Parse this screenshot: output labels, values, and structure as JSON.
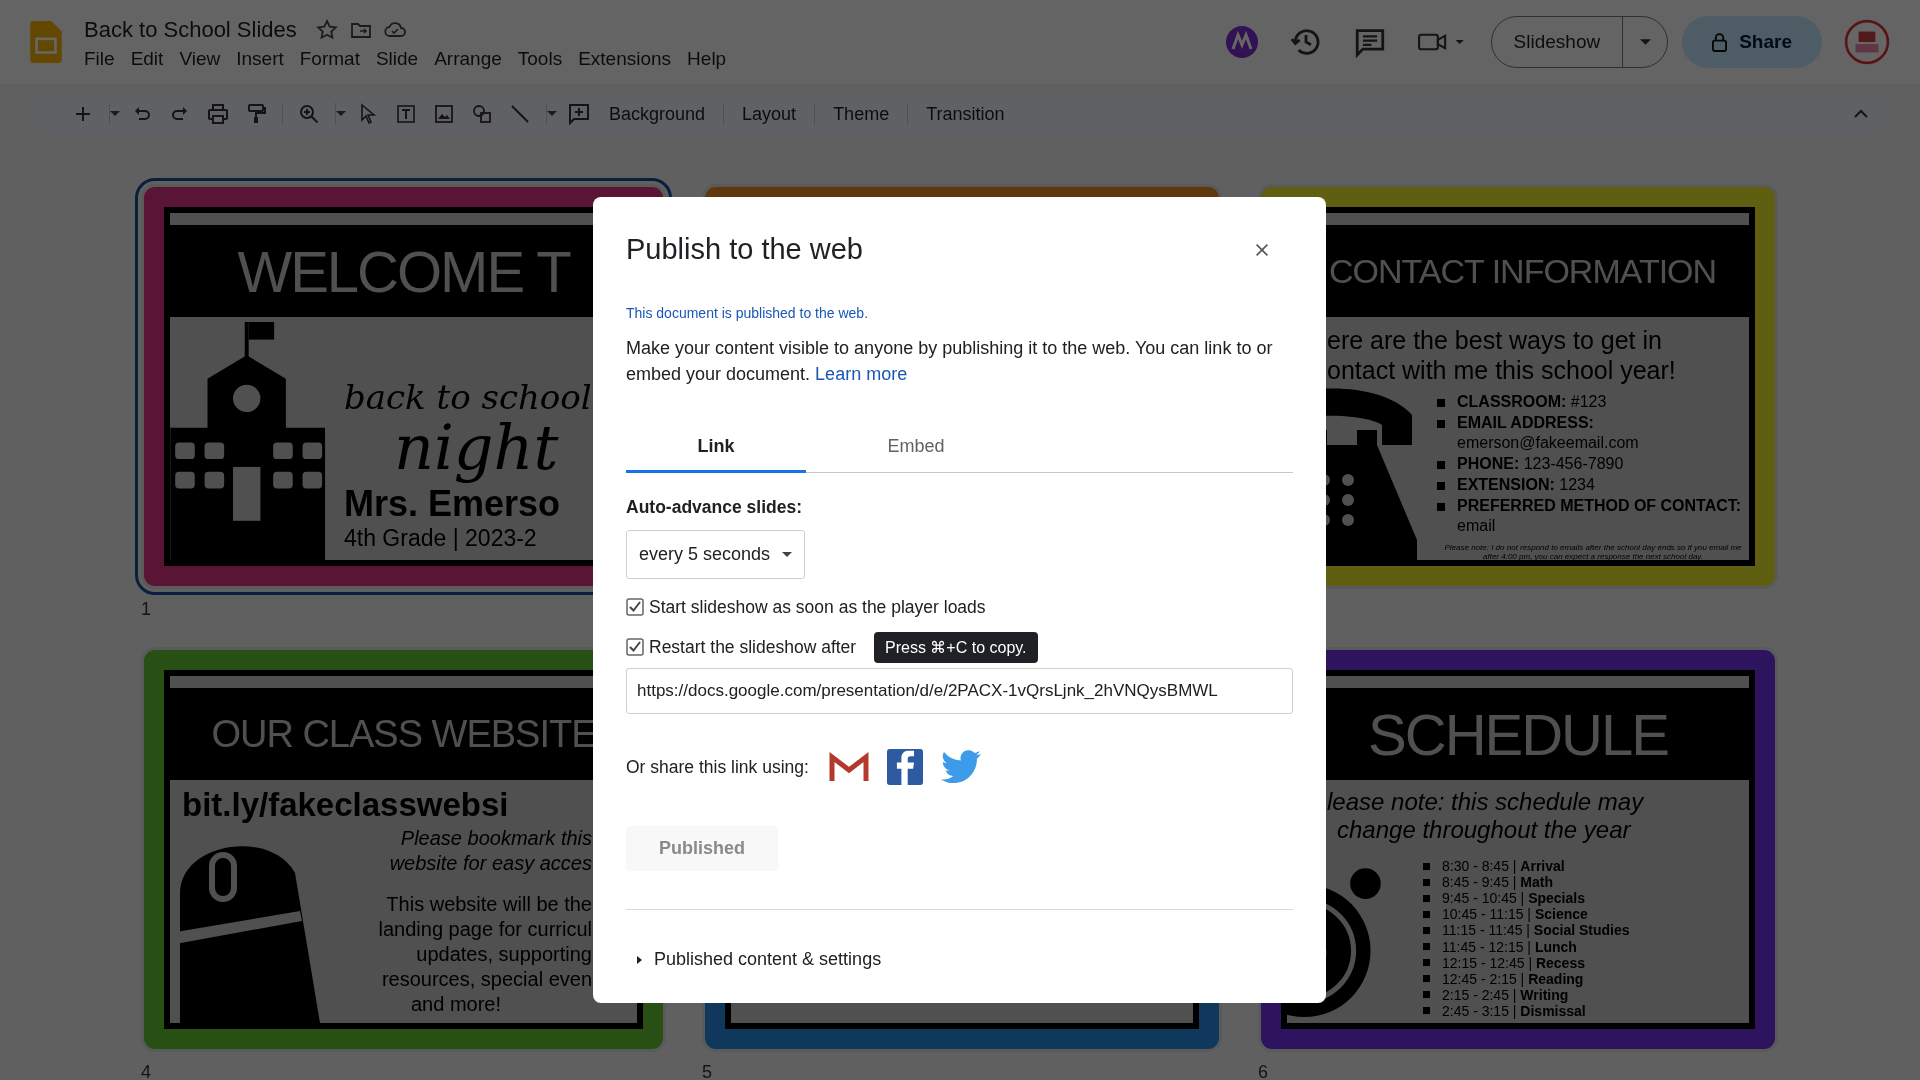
{
  "document": {
    "title": "Back to School Slides"
  },
  "menu": [
    "File",
    "Edit",
    "View",
    "Insert",
    "Format",
    "Slide",
    "Arrange",
    "Tools",
    "Extensions",
    "Help"
  ],
  "actions": {
    "slideshow": "Slideshow",
    "share": "Share"
  },
  "toolbar": [
    "Background",
    "Layout",
    "Theme",
    "Transition"
  ],
  "slides": [
    {
      "number": "1",
      "kind": "welcome",
      "selected": true,
      "title": "WELCOME T",
      "lines": [
        "back to school",
        "night",
        "Mrs. Emerso",
        "4th Grade | 2023-2"
      ]
    },
    {
      "kind": "hidden",
      "selected": false
    },
    {
      "kind": "contact",
      "selected": false,
      "title": "CONTACT INFORMATION",
      "intro": [
        "ere are the best ways to get in",
        "ontact with me this school year!"
      ],
      "items": [
        "**CLASSROOM:** #123",
        "**EMAIL ADDRESS:** emerson@fakeemail.com",
        "**PHONE:** 123-456-7890",
        "**EXTENSION:** 1234",
        "**PREFERRED METHOD OF CONTACT:** email"
      ],
      "note": "Please note: I do not respond to emails after the school day ends so if you email me after 4:00 pm, you can expect a response the next school day."
    },
    {
      "number": "4",
      "kind": "website",
      "selected": false,
      "title": "OUR CLASS WEBSITE",
      "link": "bit.ly/fakeclasswebsi",
      "lines": [
        "Please bookmark this",
        "website for easy acces",
        "This website will be the",
        "landing page for curricul",
        "updates, supporting",
        "resources, special even",
        "and more!"
      ]
    },
    {
      "number": "5",
      "kind": "hidden",
      "selected": false
    },
    {
      "number": "6",
      "kind": "schedule",
      "selected": false,
      "title": "SCHEDULE",
      "intro": [
        "lease note: this schedule may",
        "change throughout the year"
      ],
      "items": [
        "8:30 - 8:45 | **Arrival**",
        "8:45 - 9:45 | **Math**",
        "9:45 - 10:45 | **Specials**",
        "10:45 - 11:15 | **Science**",
        "11:15 - 11:45 | **Social Studies**",
        "11:45 - 12:15 | **Lunch**",
        "12:15 - 12:45 | **Recess**",
        "12:45 - 2:15 | **Reading**",
        "2:15 - 2:45 | **Writing**",
        "2:45 - 3:15 | **Dismissal**"
      ]
    }
  ],
  "dialog": {
    "title": "Publish to the web",
    "status": "This document is published to the web.",
    "description": "Make your content visible to anyone by publishing it to the web. You can link to or embed your document.",
    "learn_more": "Learn more",
    "tabs": [
      {
        "label": "Link",
        "selected": true
      },
      {
        "label": "Embed",
        "selected": false
      }
    ],
    "auto_advance": {
      "label": "Auto-advance slides:",
      "value": "every 5 seconds"
    },
    "options": [
      {
        "label": "Start slideshow as soon as the player loads",
        "checked": true
      },
      {
        "label": "Restart the slideshow after",
        "checked": true
      }
    ],
    "tooltip": "Press ⌘+C to copy.",
    "url": "https://docs.google.com/presentation/d/e/2PACX-1vQrsLjnk_2hVNQysBMWL",
    "share_label": "Or share this link using:",
    "publish_button": {
      "label": "Published",
      "disabled": true
    },
    "settings": {
      "label": "Published content & settings",
      "expanded": false
    }
  }
}
